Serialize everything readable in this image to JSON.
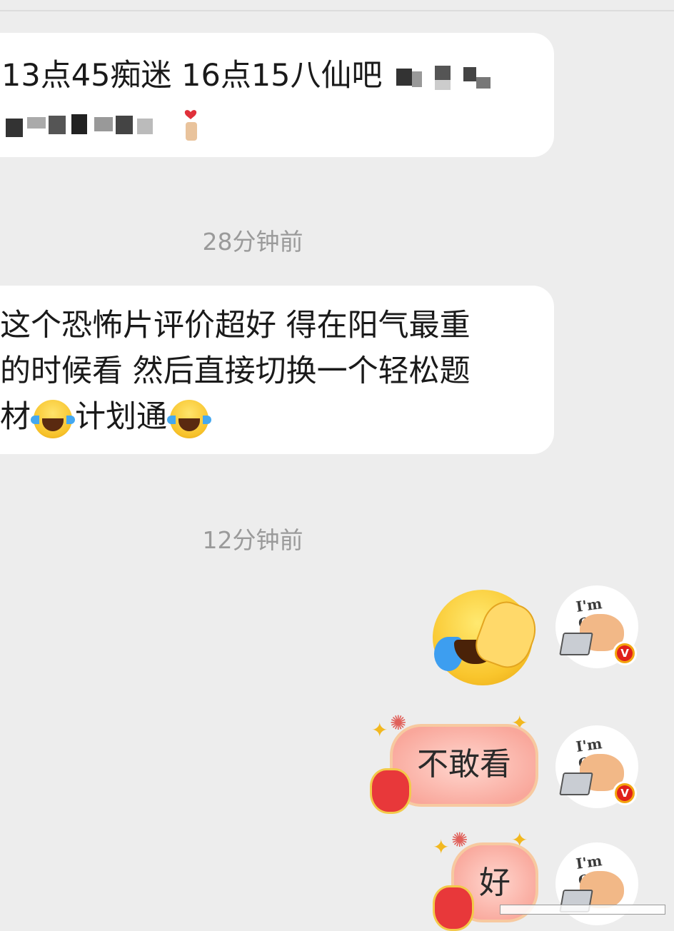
{
  "messages": [
    {
      "line1": "13点45痴迷 16点15八仙吧",
      "line2": ""
    },
    {
      "timestamp": "28分钟前",
      "line1": "这个恐怖片评价超好 得在阳气最重",
      "line2": "的时候看 然后直接切换一个轻松题",
      "line3_a": "材",
      "line3_b": "计划通"
    },
    {
      "timestamp": "12分钟前"
    }
  ],
  "outgoing": {
    "avatar_caption": "I'm OK!",
    "badge": "V",
    "sticker_1": "不敢看",
    "sticker_2": "好"
  },
  "icons": {
    "laugh_emoji": "face-with-tears-of-joy-icon",
    "facepalm_emoji": "facepalm-laugh-icon",
    "verified_badge": "verified-v-icon",
    "heart_finger": "finger-heart-icon"
  },
  "colors": {
    "background": "#ededed",
    "incoming_bubble": "#ffffff",
    "timestamp_text": "#9a9a9a",
    "badge": "#f3a510"
  }
}
